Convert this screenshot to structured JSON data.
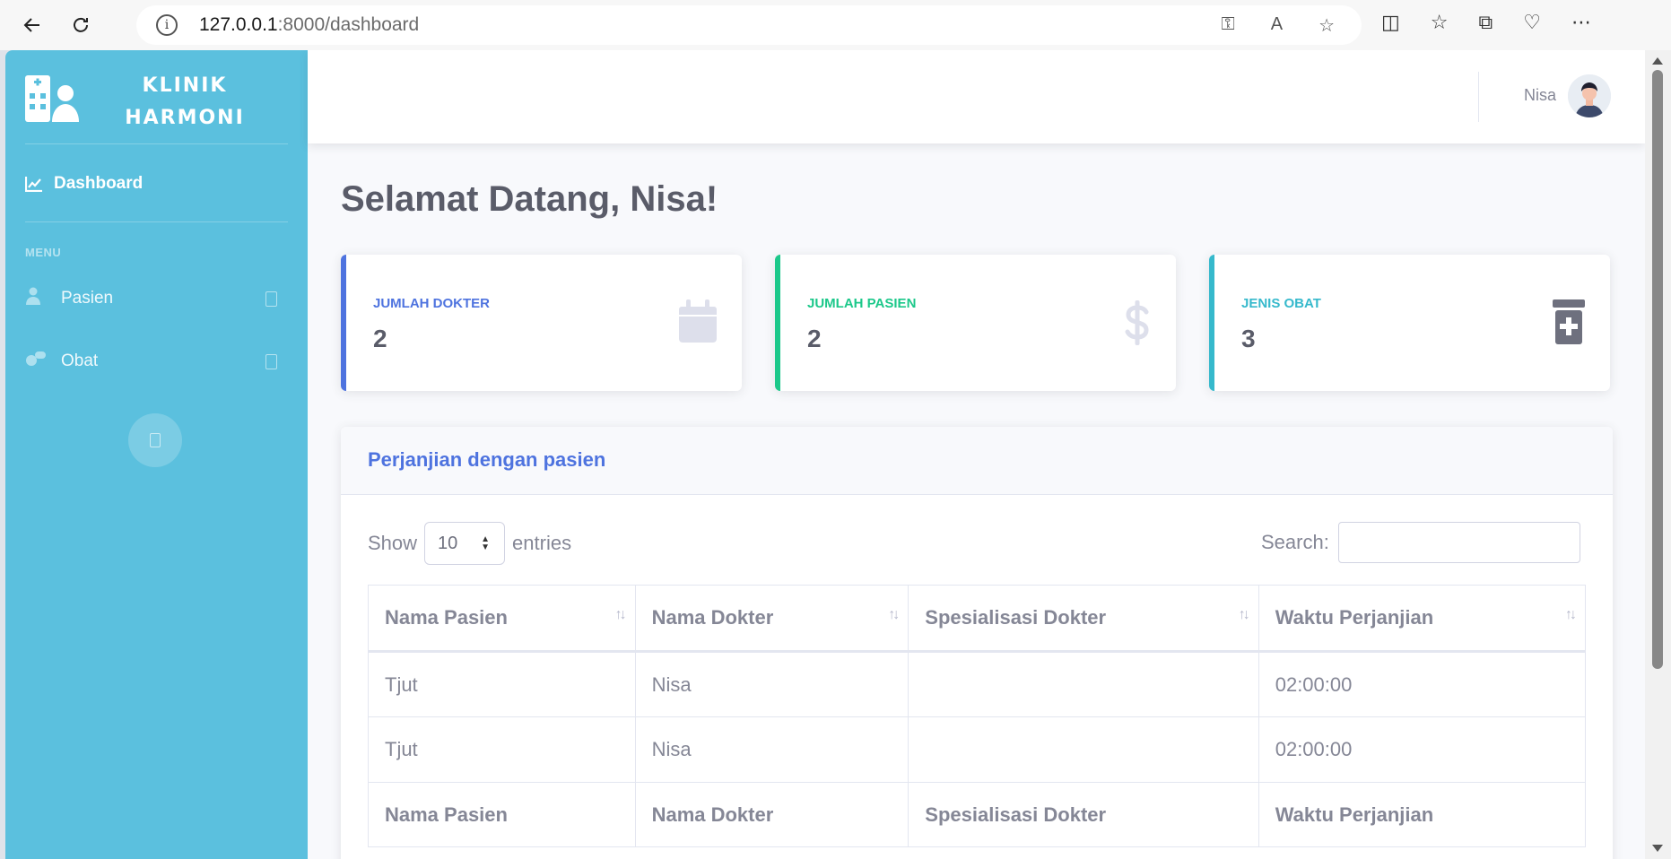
{
  "browser": {
    "url_host": "127.0.0.1",
    "url_rest": ":8000/dashboard"
  },
  "sidebar": {
    "brand_line1": "KLINIK",
    "brand_line2": "HARMONI",
    "dashboard_label": "Dashboard",
    "menu_heading": "MENU",
    "items": [
      {
        "label": "Pasien",
        "icon": "user-injured-icon"
      },
      {
        "label": "Obat",
        "icon": "pills-icon"
      }
    ]
  },
  "topbar": {
    "user_name": "Nisa"
  },
  "page": {
    "title": "Selamat Datang, Nisa!"
  },
  "cards": [
    {
      "label": "JUMLAH DOKTER",
      "value": "2",
      "color": "#4e73df",
      "icon": "calendar-icon"
    },
    {
      "label": "JUMLAH PASIEN",
      "value": "2",
      "color": "#1cc88a",
      "icon": "dollar-icon"
    },
    {
      "label": "JENIS OBAT",
      "value": "3",
      "color": "#36b9cc",
      "icon": "trash-medical-icon"
    }
  ],
  "panel": {
    "title": "Perjanjian dengan pasien",
    "show_label": "Show",
    "entries_value": "10",
    "entries_label": "entries",
    "search_label": "Search:"
  },
  "table": {
    "columns": [
      "Nama Pasien",
      "Nama Dokter",
      "Spesialisasi Dokter",
      "Waktu Perjanjian"
    ],
    "rows": [
      [
        "Tjut",
        "Nisa",
        "",
        "02:00:00"
      ],
      [
        "Tjut",
        "Nisa",
        "",
        "02:00:00"
      ]
    ]
  },
  "colors": {
    "sidebar": "#5bc0de",
    "primary": "#4e73df",
    "success": "#1cc88a",
    "info": "#36b9cc"
  }
}
